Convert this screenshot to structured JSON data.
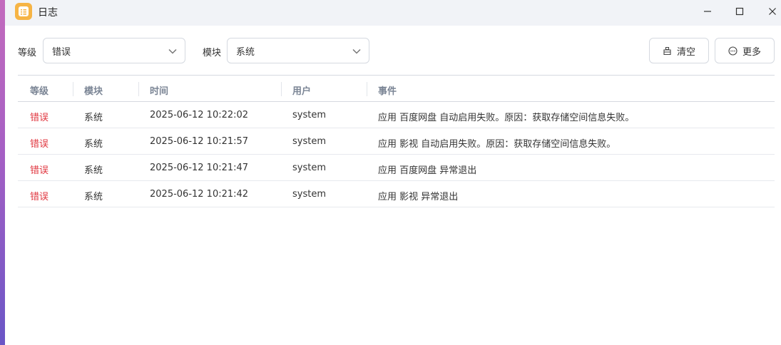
{
  "window": {
    "title": "日志",
    "controls": {
      "minimize": "minimize-icon",
      "maximize": "maximize-icon",
      "close": "close-icon"
    }
  },
  "filters": {
    "level_label": "等级",
    "level_value": "错误",
    "module_label": "模块",
    "module_value": "系统"
  },
  "toolbar": {
    "clear_label": "清空",
    "more_label": "更多"
  },
  "table": {
    "headers": [
      "等级",
      "模块",
      "时间",
      "用户",
      "事件"
    ],
    "rows": [
      {
        "level": "错误",
        "module": "系统",
        "time": "2025-06-12 10:22:02",
        "user": "system",
        "event": "应用 百度网盘 自动启用失败。原因：获取存储空间信息失败。"
      },
      {
        "level": "错误",
        "module": "系统",
        "time": "2025-06-12 10:21:57",
        "user": "system",
        "event": "应用 影视 自动启用失败。原因：获取存储空间信息失败。"
      },
      {
        "level": "错误",
        "module": "系统",
        "time": "2025-06-12 10:21:47",
        "user": "system",
        "event": "应用 百度网盘 异常退出"
      },
      {
        "level": "错误",
        "module": "系统",
        "time": "2025-06-12 10:21:42",
        "user": "system",
        "event": "应用 影视 异常退出"
      }
    ]
  },
  "colors": {
    "error": "#e0363f",
    "header_text": "#7b8595",
    "titlebar_bg": "#f1f3f7",
    "app_icon": "#f6b445"
  }
}
